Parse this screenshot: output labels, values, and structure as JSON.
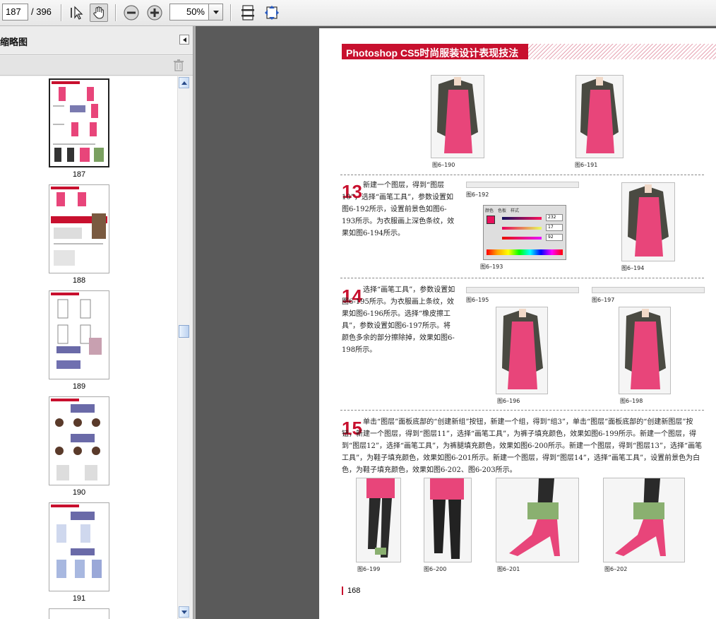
{
  "toolbar": {
    "current_page": "187",
    "total_pages": "/ 396",
    "zoom": "50%",
    "icons": [
      "select-cursor-icon",
      "hand-tool-icon",
      "zoom-out-icon",
      "zoom-in-icon",
      "fit-page-icon",
      "fit-width-icon"
    ]
  },
  "sidebar": {
    "title": "缩略图",
    "thumbnails": [
      {
        "label": "187",
        "selected": true
      },
      {
        "label": "188",
        "selected": false
      },
      {
        "label": "189",
        "selected": false
      },
      {
        "label": "190",
        "selected": false
      },
      {
        "label": "191",
        "selected": false
      }
    ]
  },
  "page": {
    "header": "Photoshop CS5时尚服装设计表现技法",
    "page_number": "168",
    "captions": {
      "f190": "图6–190",
      "f191": "图6–191",
      "f192": "图6–192",
      "f193": "图6–193",
      "f194": "图6–194",
      "f195": "图6–195",
      "f196": "图6–196",
      "f197": "图6–197",
      "f198": "图6–198",
      "f199": "图6–199",
      "f200": "图6–200",
      "f201": "图6–201",
      "f202": "图6–202"
    },
    "steps": {
      "s13_num": "13",
      "s13_text": "新建一个图层，得到“图层10”，选择“画笔工具”，参数设置如图6-192所示，设置前景色如图6-193所示。为衣服画上深色条纹，效果如图6-194所示。",
      "s14_num": "14",
      "s14_text": "选择“画笔工具”，参数设置如图6-195所示。为衣服画上条纹，效果如图6-196所示。选择“橡皮擦工具”，参数设置如图6-197所示。将颜色多余的部分擦除掉，效果如图6-198所示。",
      "s15_num": "15",
      "s15_text": "单击“图层”面板底部的“创建新组”按钮，新建一个组，得到“组3”，单击“图层”面板底部的“创建新图层”按钮，新建一个图层，得到“图层11”，选择“画笔工具”，为裤子填充颜色，效果如图6-199所示。新建一个图层，得到“图层12”，选择“画笔工具”，为裤腿填充颜色，效果如图6-200所示。新建一个图层，得到“图层13”，选择“画笔工具”，为鞋子填充颜色，效果如图6-201所示。新建一个图层，得到“图层14”，选择“画笔工具”，设置前景色为白色，为鞋子填充颜色，效果如图6-202、图6-203所示。"
    },
    "color_panel": {
      "tabs": [
        "颜色",
        "色板",
        "样式"
      ],
      "r": "232",
      "g": "17",
      "b": "92"
    }
  },
  "colors": {
    "accent_red": "#c8102e",
    "garment_pink": "#e8457a",
    "swatch": "#e8115c"
  }
}
